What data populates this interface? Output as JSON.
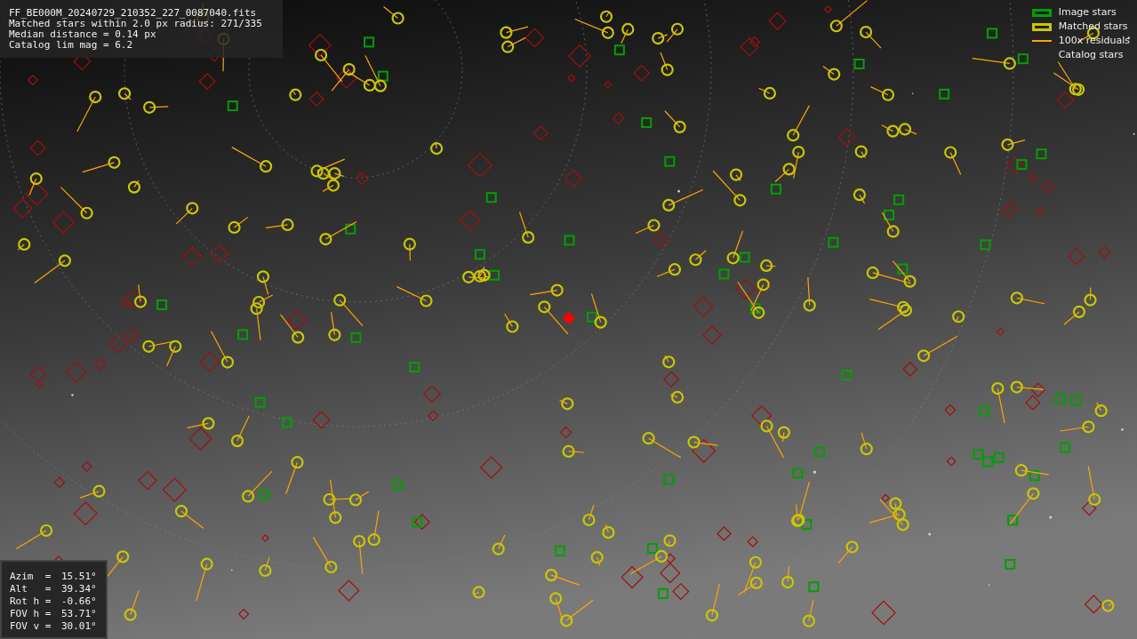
{
  "info_lines": [
    "FF_BE000M_20240729_210352_227_0087040.fits",
    "Matched stars within 2.0 px radius: 271/335",
    "Median distance = 0.14 px",
    "Catalog lim mag = 6.2"
  ],
  "legend": [
    {
      "label": "Image stars",
      "color": "#00a000"
    },
    {
      "kind": "matched",
      "label": "Matched stars",
      "color": "#c8c800"
    },
    {
      "kind": "residual",
      "label": "100x residuals",
      "color": "#ffa500"
    },
    {
      "kind": "catalog",
      "label": "Catalog stars"
    }
  ],
  "readout": [
    {
      "label": "Azim  =",
      "value": "15.51°"
    },
    {
      "label": "Alt   =",
      "value": "39.34°"
    },
    {
      "label": "Rot h =",
      "value": "-0.66°"
    },
    {
      "label": "FOV h =",
      "value": "53.71°"
    },
    {
      "label": "FOV v =",
      "value": "30.01°"
    }
  ]
}
